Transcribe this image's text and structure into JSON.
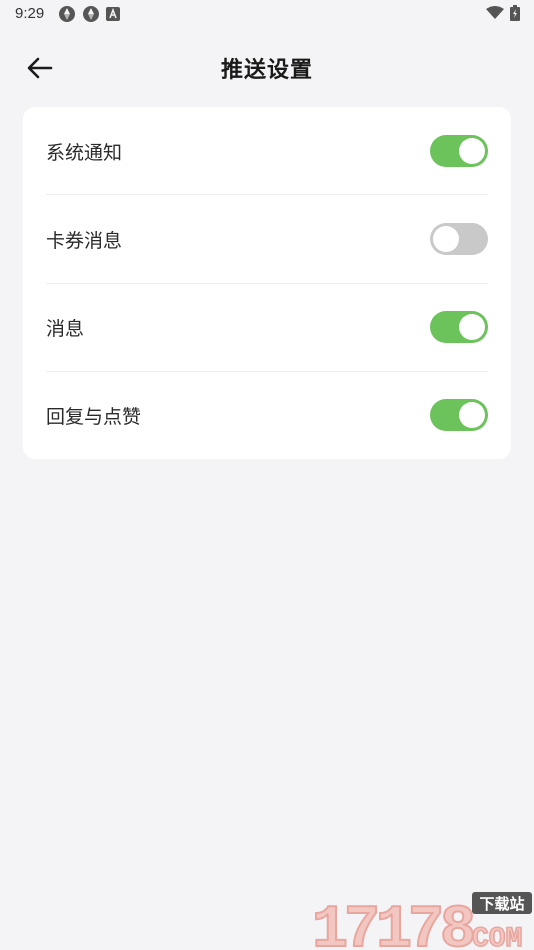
{
  "status_bar": {
    "time": "9:29",
    "left_icons": [
      "sync-icon",
      "sync-icon",
      "app-a-icon"
    ],
    "right_icons": [
      "wifi-icon",
      "battery-icon"
    ]
  },
  "header": {
    "title": "推送设置",
    "back_icon": "arrow-left-icon"
  },
  "settings": [
    {
      "label": "系统通知",
      "enabled": true
    },
    {
      "label": "卡券消息",
      "enabled": false
    },
    {
      "label": "消息",
      "enabled": true
    },
    {
      "label": "回复与点赞",
      "enabled": true
    }
  ],
  "watermark": {
    "number": "17178",
    "badge": "下载站",
    "suffix": "COM"
  },
  "colors": {
    "toggle_on": "#6cc25b",
    "toggle_off": "#c9c9c9",
    "background": "#f4f4f7",
    "card": "#ffffff"
  }
}
